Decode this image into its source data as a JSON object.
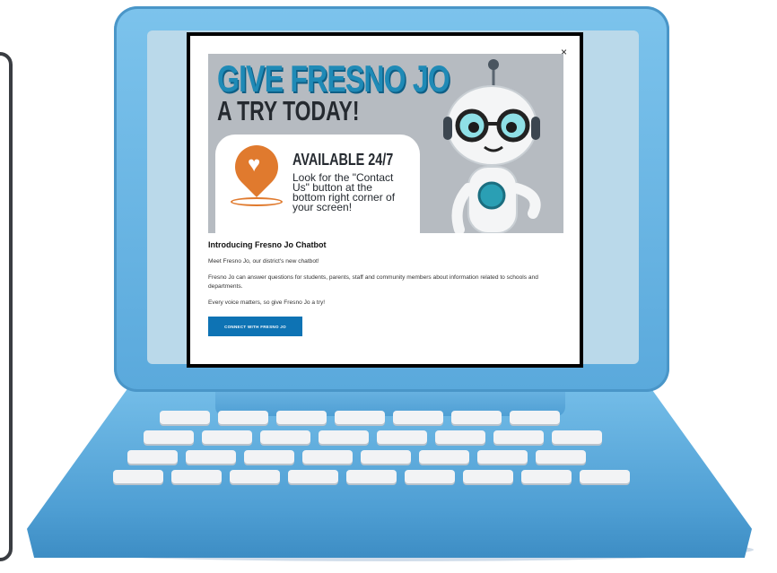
{
  "banner": {
    "title_line1": "GIVE FRESNO JO",
    "title_line2": "A TRY TODAY!",
    "card_heading": "AVAILABLE 24/7",
    "card_text": "Look for the \"Contact Us\" button at the bottom right corner of your screen!"
  },
  "modal": {
    "close_label": "×",
    "title": "Introducing Fresno Jo Chatbot",
    "paragraphs": [
      "Meet Fresno Jo, our district's new chatbot!",
      "Fresno Jo can answer questions for students, parents, staff and community members about information related to schools and departments.",
      "Every voice matters, so give Fresno Jo a try!"
    ],
    "button_label": "CONNECT WITH FRESNO JO"
  },
  "colors": {
    "laptop_blue": "#5aa9dc",
    "title_blue": "#1f8ab6",
    "pin_orange": "#e07a2e",
    "button_blue": "#0e73b4",
    "banner_gray": "#b6bbc1"
  },
  "icons": [
    "close-icon",
    "location-heart-icon",
    "robot-mascot"
  ]
}
